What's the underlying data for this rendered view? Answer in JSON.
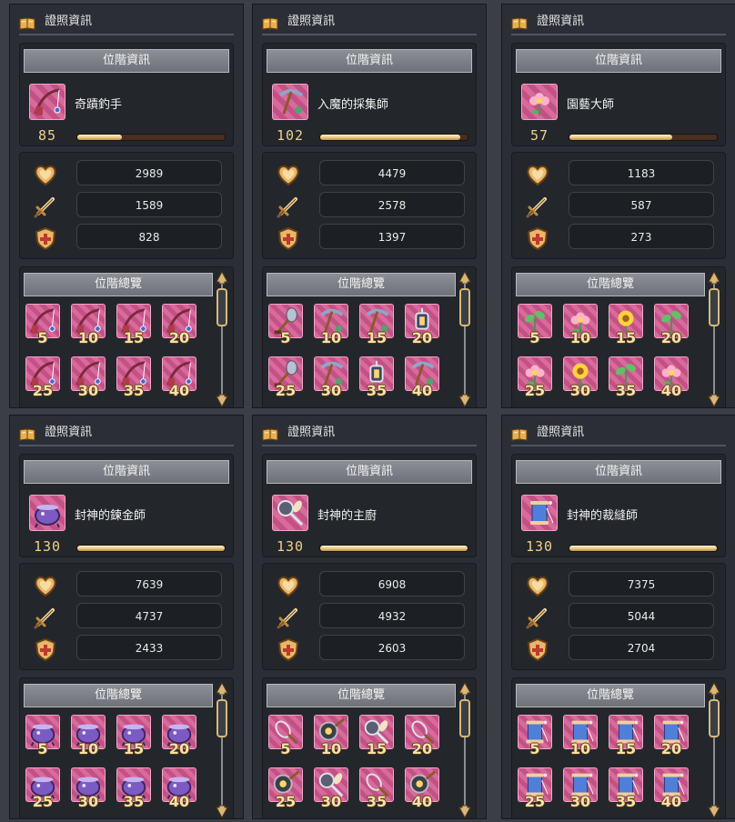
{
  "panel_title": "證照資訊",
  "rank_info_label": "位階資訊",
  "rank_overview_label": "位階總覽",
  "stat_icons": [
    "heart-icon",
    "sword-icon",
    "shield-icon"
  ],
  "colors": {
    "panel_bg": "#2b2f35",
    "header_bar": "#7f8389",
    "cell_pink": "#d96a9c",
    "level_gold": "#f1cf8a",
    "bar_fill": "#e8c27a"
  },
  "panels": [
    {
      "job_name": "奇蹟釣手",
      "job_icon": "fishing-rod-icon",
      "level": "85",
      "progress": 0.3,
      "stats": [
        "2989",
        "1589",
        "828"
      ],
      "tiers": [
        {
          "label": "5",
          "icon": "fishing-rod-icon"
        },
        {
          "label": "10",
          "icon": "fishing-rod-icon"
        },
        {
          "label": "15",
          "icon": "fishing-rod-icon"
        },
        {
          "label": "20",
          "icon": "fishing-rod-icon"
        },
        {
          "label": "25",
          "icon": "fishing-rod-icon"
        },
        {
          "label": "30",
          "icon": "fishing-rod-icon"
        },
        {
          "label": "35",
          "icon": "fishing-rod-icon"
        },
        {
          "label": "40",
          "icon": "fishing-rod-icon"
        }
      ]
    },
    {
      "job_name": "入魔的採集師",
      "job_icon": "pickaxe-icon",
      "level": "102",
      "progress": 0.95,
      "stats": [
        "4479",
        "2578",
        "1397"
      ],
      "tiers": [
        {
          "label": "5",
          "icon": "shovel-icon"
        },
        {
          "label": "10",
          "icon": "pickaxe-icon"
        },
        {
          "label": "15",
          "icon": "pickaxe-icon"
        },
        {
          "label": "20",
          "icon": "lantern-icon"
        },
        {
          "label": "25",
          "icon": "shovel-icon"
        },
        {
          "label": "30",
          "icon": "pickaxe-icon"
        },
        {
          "label": "35",
          "icon": "lantern-icon"
        },
        {
          "label": "40",
          "icon": "pickaxe-icon"
        }
      ]
    },
    {
      "job_name": "園藝大師",
      "job_icon": "flower-icon",
      "level": "57",
      "progress": 0.7,
      "stats": [
        "1183",
        "587",
        "273"
      ],
      "tiers": [
        {
          "label": "5",
          "icon": "sprout-icon"
        },
        {
          "label": "10",
          "icon": "flower-icon"
        },
        {
          "label": "15",
          "icon": "sunflower-icon"
        },
        {
          "label": "20",
          "icon": "sprout-icon"
        },
        {
          "label": "25",
          "icon": "flower-icon"
        },
        {
          "label": "30",
          "icon": "sunflower-icon"
        },
        {
          "label": "35",
          "icon": "sprout-icon"
        },
        {
          "label": "40",
          "icon": "flower-icon"
        }
      ]
    },
    {
      "job_name": "封神的鍊金師",
      "job_icon": "cauldron-icon",
      "level": "130",
      "progress": 1.0,
      "stats": [
        "7639",
        "4737",
        "2433"
      ],
      "tiers": [
        {
          "label": "5",
          "icon": "cauldron-icon"
        },
        {
          "label": "10",
          "icon": "cauldron-icon"
        },
        {
          "label": "15",
          "icon": "cauldron-icon"
        },
        {
          "label": "20",
          "icon": "cauldron-icon"
        },
        {
          "label": "25",
          "icon": "cauldron-icon"
        },
        {
          "label": "30",
          "icon": "cauldron-icon"
        },
        {
          "label": "35",
          "icon": "cauldron-icon"
        },
        {
          "label": "40",
          "icon": "cauldron-icon"
        }
      ]
    },
    {
      "job_name": "封神的主廚",
      "job_icon": "cooking-tools-icon",
      "level": "130",
      "progress": 1.0,
      "stats": [
        "6908",
        "4932",
        "2603"
      ],
      "tiers": [
        {
          "label": "5",
          "icon": "whisk-icon"
        },
        {
          "label": "10",
          "icon": "pan-icon"
        },
        {
          "label": "15",
          "icon": "cooking-tools-icon"
        },
        {
          "label": "20",
          "icon": "whisk-icon"
        },
        {
          "label": "25",
          "icon": "pan-icon"
        },
        {
          "label": "30",
          "icon": "cooking-tools-icon"
        },
        {
          "label": "35",
          "icon": "whisk-icon"
        },
        {
          "label": "40",
          "icon": "pan-icon"
        }
      ]
    },
    {
      "job_name": "封神的裁縫師",
      "job_icon": "thread-spool-icon",
      "level": "130",
      "progress": 1.0,
      "stats": [
        "7375",
        "5044",
        "2704"
      ],
      "tiers": [
        {
          "label": "5",
          "icon": "thread-spool-icon"
        },
        {
          "label": "10",
          "icon": "thread-spool-icon"
        },
        {
          "label": "15",
          "icon": "thread-spool-icon"
        },
        {
          "label": "20",
          "icon": "thread-spool-icon"
        },
        {
          "label": "25",
          "icon": "thread-spool-icon"
        },
        {
          "label": "30",
          "icon": "thread-spool-icon"
        },
        {
          "label": "35",
          "icon": "thread-spool-icon"
        },
        {
          "label": "40",
          "icon": "thread-spool-icon"
        }
      ]
    }
  ]
}
